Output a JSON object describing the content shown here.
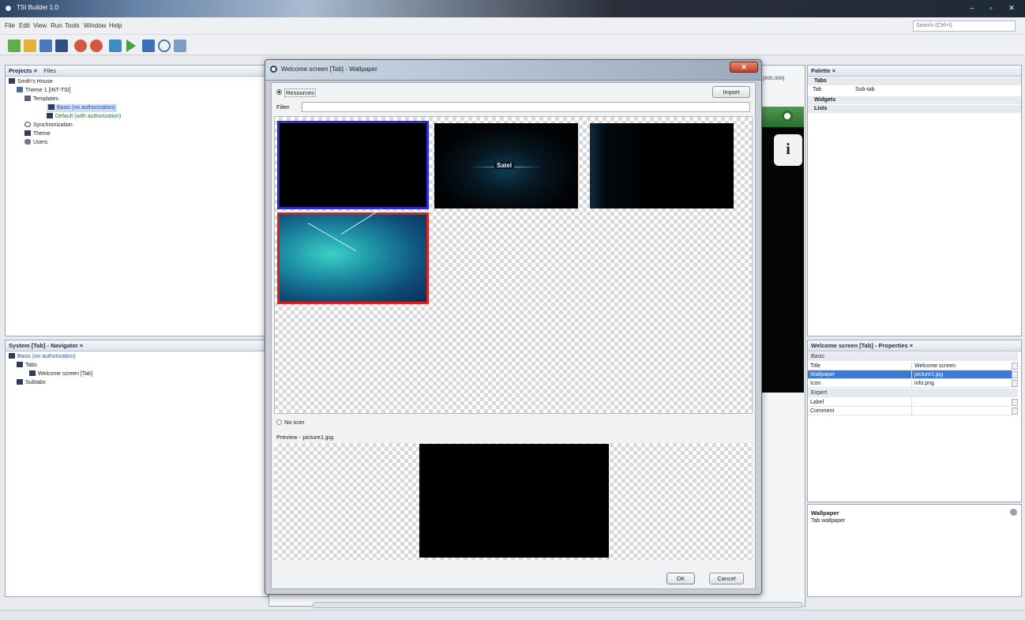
{
  "window": {
    "title": "TSI Builder 1.0",
    "controls": {
      "minimize": "–",
      "maximize": "▫",
      "close": "✕"
    }
  },
  "menu": {
    "items": [
      "File",
      "Edit",
      "View",
      "Run",
      "Tools",
      "Window",
      "Help"
    ]
  },
  "search": {
    "placeholder": "Search (Ctrl+I)"
  },
  "projects_panel": {
    "tabs": [
      "Projects ×",
      "Files"
    ],
    "tree": [
      {
        "label": "Smith's House"
      },
      {
        "label": "Theme 1 [INT-TSI]"
      },
      {
        "label": "Templates"
      },
      {
        "label": "Basic (no authorization)"
      },
      {
        "label": "Default (with authorization)"
      },
      {
        "label": "Synchronization"
      },
      {
        "label": "Theme"
      },
      {
        "label": "Users"
      }
    ]
  },
  "navigator_panel": {
    "title": "System [Tab] - Navigator ×",
    "tree": [
      {
        "label": "Basic (no authorization)"
      },
      {
        "label": "Tabs"
      },
      {
        "label": "Welcome screen [Tab]"
      },
      {
        "label": "Subtabs"
      }
    ]
  },
  "editor": {
    "zoom": "[000,000]"
  },
  "dialog": {
    "title": "Welcome screen [Tab] - Wallpaper",
    "close": "✕",
    "resources_label": "Resources",
    "import_label": "Import",
    "filter_label": "Filter",
    "filter_value": "",
    "thumbnails": [
      {
        "name": "black",
        "selected": true
      },
      {
        "name": "satel",
        "logo_text": "Satel"
      },
      {
        "name": "dark-glow"
      },
      {
        "name": "teal-lines",
        "highlighted": true
      }
    ],
    "no_icon_label": "No icon",
    "preview_label": "Preview - picture1.jpg",
    "ok_label": "OK",
    "cancel_label": "Cancel"
  },
  "palette_panel": {
    "title": "Palette ×",
    "sections": [
      {
        "label": "Tabs",
        "items": [
          "Tab",
          "Sub-tab"
        ]
      },
      {
        "label": "Widgets"
      },
      {
        "label": "Lists"
      }
    ]
  },
  "properties_panel": {
    "title": "Welcome screen [Tab] - Properties ×",
    "sections": [
      {
        "label": "Basic",
        "rows": [
          {
            "key": "Title",
            "value": "Welcome screen"
          },
          {
            "key": "Wallpaper",
            "value": "picture1.jpg",
            "selected": true
          },
          {
            "key": "Icon",
            "value": "info.png"
          }
        ]
      },
      {
        "label": "Expert",
        "rows": [
          {
            "key": "Label",
            "value": ""
          },
          {
            "key": "Comment",
            "value": ""
          }
        ]
      }
    ]
  },
  "help_panel": {
    "title": "Wallpaper",
    "text": "Tab wallpaper"
  },
  "colors": {
    "selection": "#3b7bd6",
    "thumb_selected_border": "#2b2bd8",
    "thumb_highlight_border": "#e01b1b",
    "teal": "#1c8b9c"
  }
}
